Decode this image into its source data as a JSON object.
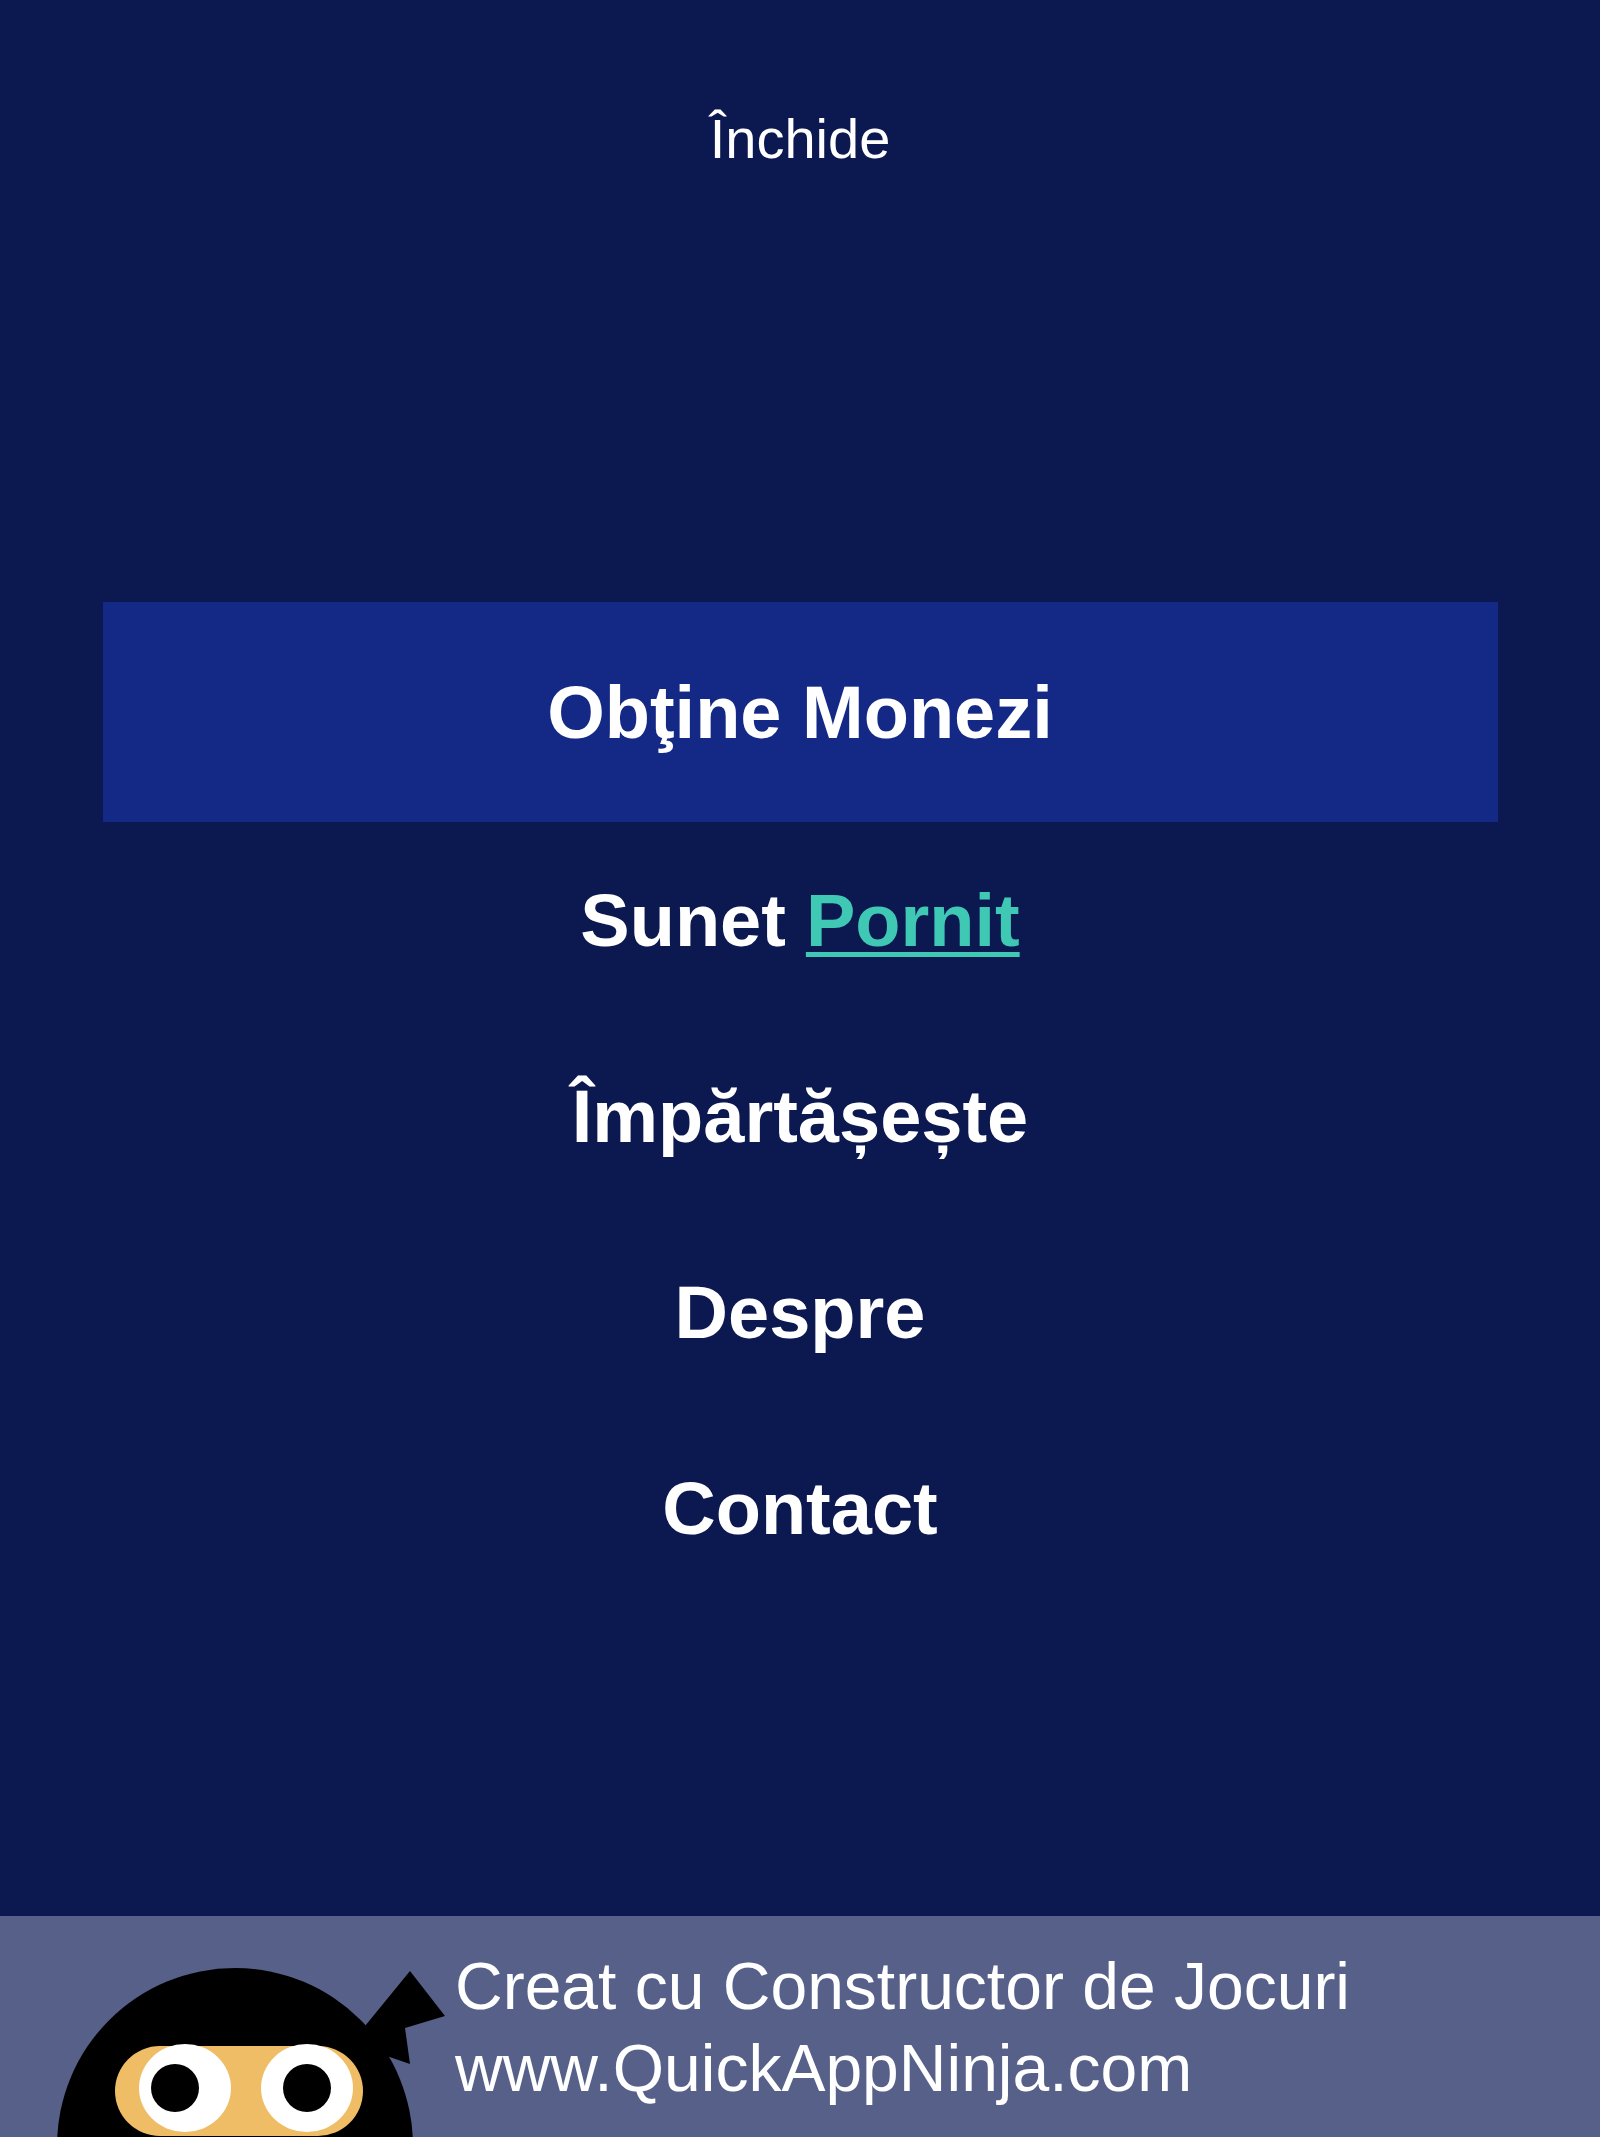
{
  "close_label": "Închide",
  "menu": [
    {
      "kind": "link",
      "label": "Obţine Monezi",
      "selected": true
    },
    {
      "kind": "toggle",
      "label": "Sunet",
      "value": "Pornit",
      "selected": false
    },
    {
      "kind": "link",
      "label": "Împărtășește",
      "selected": false
    },
    {
      "kind": "link",
      "label": "Despre",
      "selected": false
    },
    {
      "kind": "link",
      "label": "Contact",
      "selected": false
    }
  ],
  "banner": {
    "lines": [
      "Creat cu Constructor de Jocuri",
      "www.QuickAppNinja.com"
    ]
  }
}
